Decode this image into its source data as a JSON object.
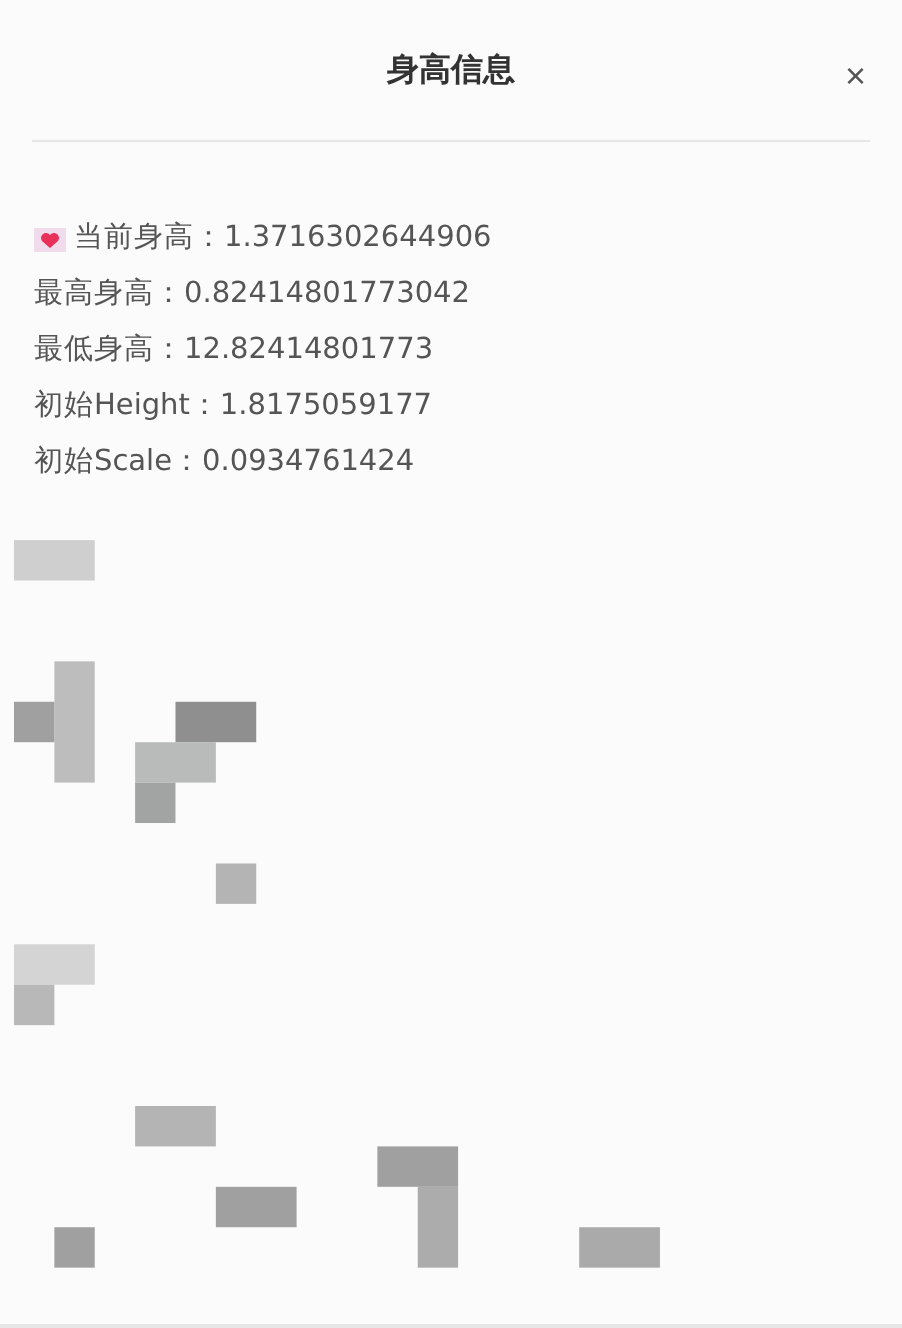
{
  "dialog": {
    "title": "身高信息",
    "close": "×"
  },
  "lines": [
    {
      "kind": "heart",
      "text": "当前身高：1.3716302644906"
    },
    {
      "kind": "plain",
      "text": "最高身高：0.82414801773042"
    },
    {
      "kind": "plain",
      "text": "最低身高：12.82414801773"
    },
    {
      "kind": "plain",
      "text": "初始Height：1.8175059177"
    },
    {
      "kind": "plain",
      "text": "初始Scale：0.0934761424"
    }
  ]
}
